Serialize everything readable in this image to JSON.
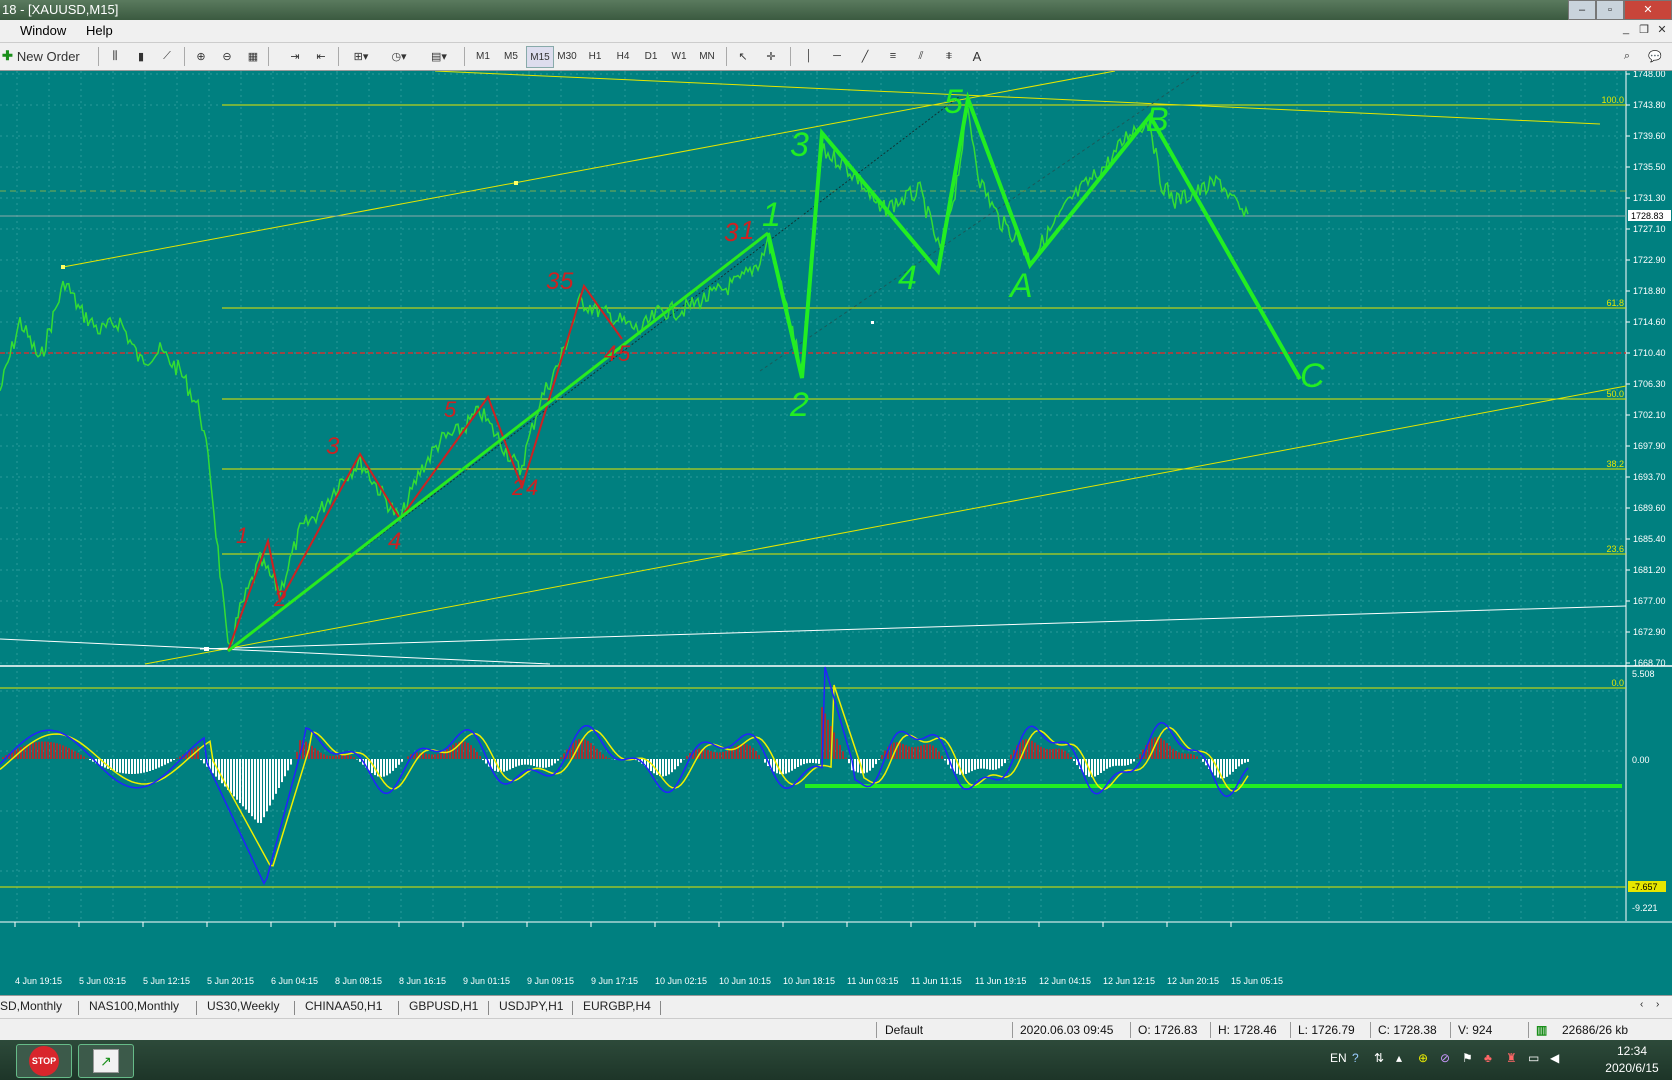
{
  "window": {
    "title": "18 - [XAUUSD,M15]"
  },
  "menu": {
    "items": [
      "Window",
      "Help"
    ]
  },
  "toolbar": {
    "new_order": "New Order",
    "timeframes": [
      "M1",
      "M5",
      "M15",
      "M30",
      "H1",
      "H4",
      "D1",
      "W1",
      "MN"
    ],
    "active_tf": "M15",
    "text_tool": "A"
  },
  "chart": {
    "price_axis": [
      "1748.00",
      "1743.80",
      "1739.60",
      "1735.50",
      "1731.30",
      "1727.10",
      "1722.90",
      "1718.80",
      "1714.60",
      "1710.40",
      "1706.30",
      "1702.10",
      "1697.90",
      "1693.70",
      "1689.60",
      "1685.40",
      "1681.20",
      "1677.00",
      "1672.90",
      "1668.70"
    ],
    "current_price": "1728.83",
    "fib_levels": [
      "100.0",
      "61.8",
      "50.0",
      "38.2",
      "23.6",
      "0.0"
    ],
    "indicator_axis": [
      "5.508",
      "0.00",
      "-9.221"
    ],
    "indicator_level": "-7.657",
    "time_axis": [
      "4 Jun 19:15",
      "5 Jun 03:15",
      "5 Jun 12:15",
      "5 Jun 20:15",
      "6 Jun 04:15",
      "8 Jun 08:15",
      "8 Jun 16:15",
      "9 Jun 01:15",
      "9 Jun 09:15",
      "9 Jun 17:15",
      "10 Jun 02:15",
      "10 Jun 10:15",
      "10 Jun 18:15",
      "11 Jun 03:15",
      "11 Jun 11:15",
      "11 Jun 19:15",
      "12 Jun 04:15",
      "12 Jun 12:15",
      "12 Jun 20:15",
      "15 Jun 05:15"
    ],
    "wave_labels_green": [
      "1",
      "2",
      "3",
      "4",
      "5",
      "A",
      "B",
      "C"
    ],
    "wave_labels_red": [
      "1",
      "2",
      "3",
      "4",
      "5",
      "2",
      "4",
      "3",
      "5",
      "4",
      "5",
      "3",
      "1"
    ],
    "colors": {
      "background": "#008080",
      "price": "#33dd33",
      "fib": "#e6e600",
      "drawing_green": "#22ee22",
      "drawing_red": "#cc2222",
      "macd_hist": "#a33333",
      "signal_yellow": "#f0f000",
      "macd_blue": "#2222ff"
    }
  },
  "symbol_tabs": [
    "SD,Monthly",
    "NAS100,Monthly",
    "US30,Weekly",
    "CHINAA50,H1",
    "GBPUSD,H1",
    "USDJPY,H1",
    "EURGBP,H4"
  ],
  "status": {
    "profile": "Default",
    "datetime": "2020.06.03 09:45",
    "open": "O: 1726.83",
    "high": "H: 1728.46",
    "low": "L: 1726.79",
    "close": "C: 1728.38",
    "volume": "V: 924",
    "traffic": "22686/26 kb"
  },
  "taskbar": {
    "lang": "EN",
    "time": "12:34",
    "date": "2020/6/15",
    "stop_label": "STOP"
  }
}
